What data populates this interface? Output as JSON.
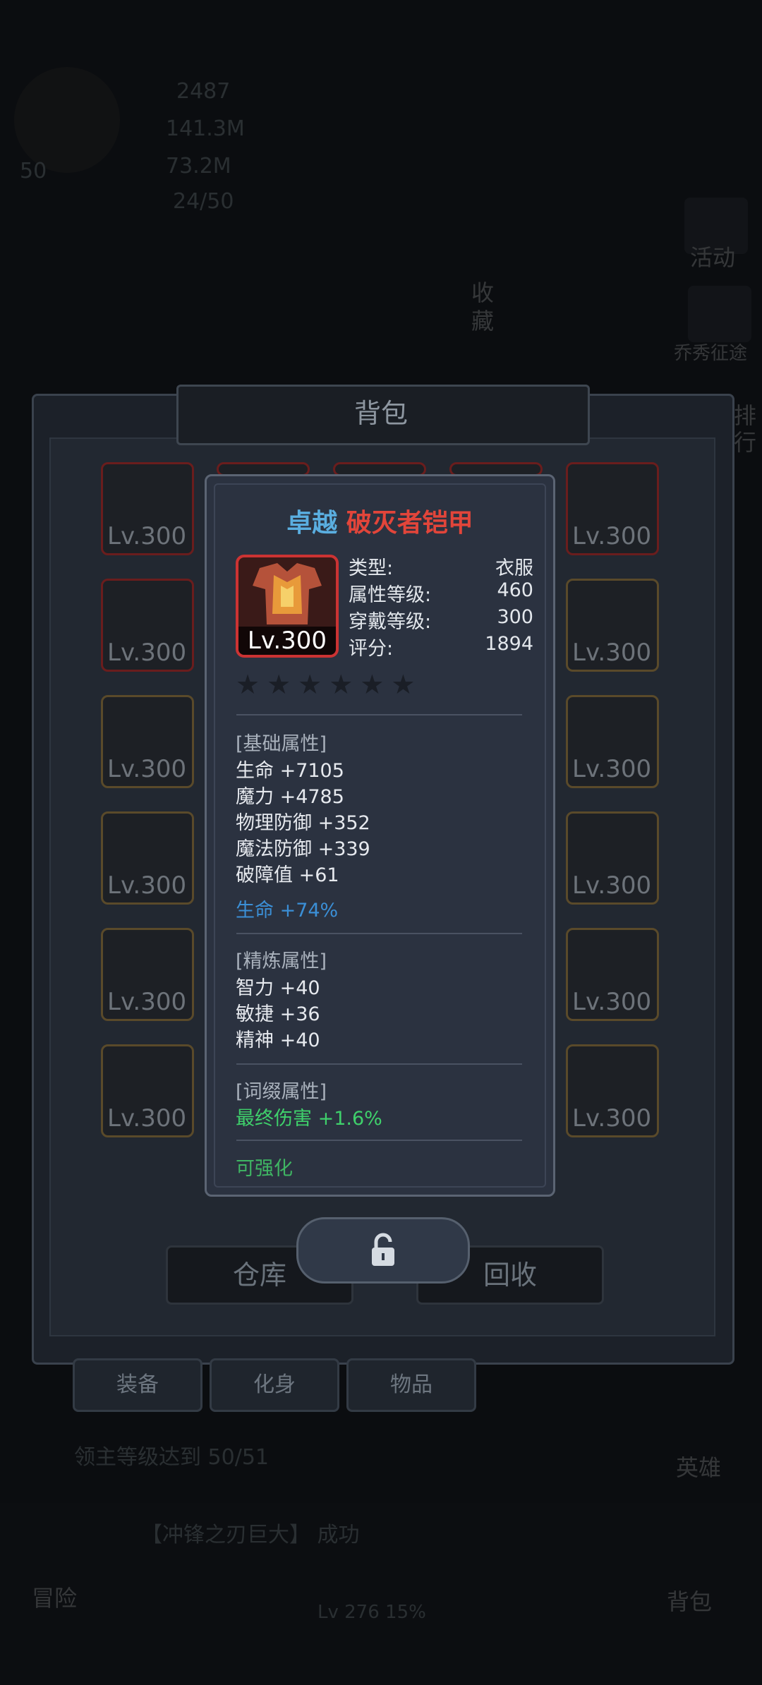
{
  "hud": {
    "level": "50",
    "diamonds": "2487",
    "gold": "141.3M",
    "coins": "73.2M",
    "energy": "24/50"
  },
  "side": {
    "activity": "活动",
    "collect": "收藏",
    "campaign": "乔秀征途",
    "rank": "排行",
    "hero": "英雄",
    "adventure": "冒险",
    "backpack": "背包"
  },
  "backpack": {
    "title": "背包",
    "warehouse": "仓库",
    "recycle": "回收",
    "tabs": [
      "装备",
      "化身",
      "物品"
    ],
    "slot_level": "Lv.300"
  },
  "quest": {
    "progress": "领主等级达到 50/51",
    "log_success": "【冲锋之刃巨大】 成功",
    "player_level": "Lv 276  15%"
  },
  "tooltip": {
    "quality": "卓越",
    "name": "破灭者铠甲",
    "level": "Lv.300",
    "stats": [
      {
        "label": "类型:",
        "value": "衣服"
      },
      {
        "label": "属性等级:",
        "value": "460"
      },
      {
        "label": "穿戴等级:",
        "value": "300"
      },
      {
        "label": "评分:",
        "value": "1894"
      }
    ],
    "stars": [
      "★",
      "★",
      "★",
      "★",
      "★",
      "★"
    ],
    "base_header": "[基础属性]",
    "base": [
      "生命 +7105",
      "魔力 +4785",
      "物理防御 +352",
      "魔法防御 +339",
      "破障值 +61"
    ],
    "base_bonus": "生命 +74%",
    "refine_header": "[精炼属性]",
    "refine": [
      "智力 +40",
      "敏捷 +36",
      "精神 +40"
    ],
    "affix_header": "[词缀属性]",
    "affix": "最终伤害 +1.6%",
    "enhance": "可强化"
  },
  "colors": {
    "quality": "#5aaee0",
    "name": "#e2453a",
    "bonus_blue": "#3b8fd6",
    "green": "#3fd06b",
    "star": "#1a1e26"
  },
  "icons": {
    "lock": "unlock-icon"
  }
}
